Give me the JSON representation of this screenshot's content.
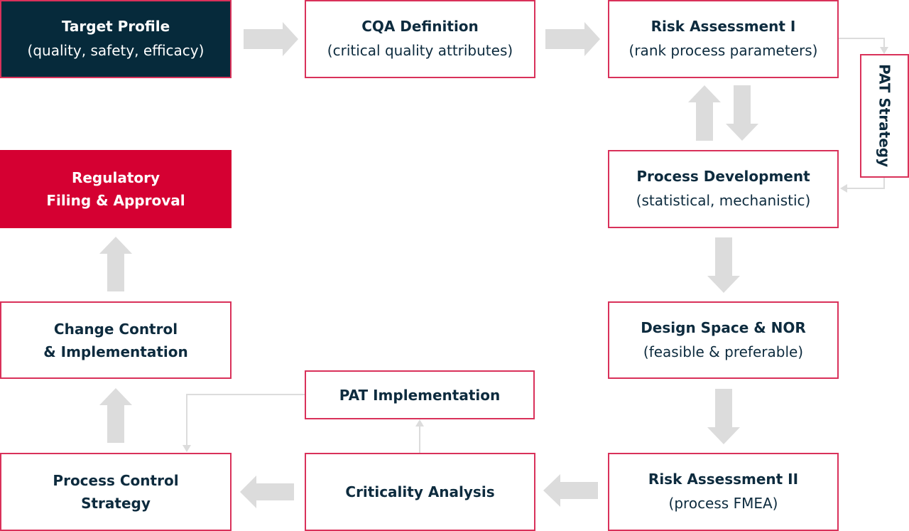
{
  "colors": {
    "border": "#d9315a",
    "dark_fill": "#062a3b",
    "red_fill": "#d50032",
    "arrow": "#dcdcdc",
    "text": "#0d2b3e"
  },
  "nodes": {
    "target_profile": {
      "title": "Target Profile",
      "subtitle": "(quality, safety, efficacy)"
    },
    "cqa_definition": {
      "title": "CQA Definition",
      "subtitle": "(critical quality attributes)"
    },
    "risk_assessment_1": {
      "title": "Risk Assessment I",
      "subtitle": "(rank process parameters)"
    },
    "pat_strategy": {
      "title": "PAT Strategy"
    },
    "process_development": {
      "title": "Process Development",
      "subtitle": "(statistical, mechanistic)"
    },
    "regulatory": {
      "title": "Regulatory",
      "title2": "Filing & Approval"
    },
    "change_control": {
      "title": "Change Control",
      "title2": "& Implementation"
    },
    "design_space": {
      "title": "Design Space & NOR",
      "subtitle": "(feasible & preferable)"
    },
    "pat_implementation": {
      "title": "PAT Implementation"
    },
    "process_control": {
      "title": "Process Control",
      "title2": "Strategy"
    },
    "criticality_analysis": {
      "title": "Criticality Analysis"
    },
    "risk_assessment_2": {
      "title": "Risk Assessment II",
      "subtitle": "(process FMEA)"
    }
  }
}
